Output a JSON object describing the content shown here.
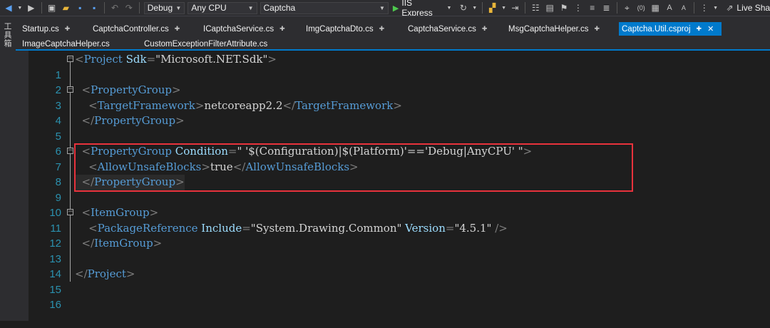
{
  "toolbar": {
    "config": "Debug",
    "platform": "Any CPU",
    "project": "Captcha",
    "run_label": "IIS Express",
    "live_share": "Live Sha"
  },
  "left_strip": {
    "label": "工具箱"
  },
  "tabs": [
    {
      "label": "Startup.cs"
    },
    {
      "label": "CaptchaController.cs"
    },
    {
      "label": "ICaptchaService.cs"
    },
    {
      "label": "ImgCaptchaDto.cs"
    },
    {
      "label": "CaptchaService.cs"
    },
    {
      "label": "MsgCaptchaHelper.cs"
    },
    {
      "label": "Captcha.Util.csproj"
    },
    {
      "label": "ImageCaptchaHelper.cs"
    },
    {
      "label": "CustomExceptionFilterAttribute.cs"
    }
  ],
  "lines": [
    {
      "n": "1",
      "open": "<",
      "tag": "Project",
      "attr": " Sdk",
      "eq": "=",
      "val": "\"Microsoft.NET.Sdk\"",
      "close": ">"
    },
    {
      "n": "2"
    },
    {
      "n": "3",
      "indent": "  ",
      "open": "<",
      "tag": "PropertyGroup",
      "close": ">"
    },
    {
      "n": "4",
      "indent": "    ",
      "open": "<",
      "tag": "TargetFramework",
      "close": ">",
      "text": "netcoreapp2.2",
      "open2": "</",
      "tag2": "TargetFramework",
      "close2": ">"
    },
    {
      "n": "5",
      "indent": "  ",
      "open": "</",
      "tag": "PropertyGroup",
      "close": ">"
    },
    {
      "n": "6"
    },
    {
      "n": "7",
      "indent": "  ",
      "open": "<",
      "tag": "PropertyGroup",
      "attr": " Condition",
      "eq": "=",
      "val": "\" '$(Configuration)|$(Platform)'=='Debug|AnyCPU' \"",
      "close": ">"
    },
    {
      "n": "8",
      "indent": "    ",
      "open": "<",
      "tag": "AllowUnsafeBlocks",
      "close": ">",
      "text": "true",
      "open2": "</",
      "tag2": "AllowUnsafeBlocks",
      "close2": ">"
    },
    {
      "n": "9",
      "indent": "  ",
      "open": "</",
      "tag": "PropertyGroup",
      "close": ">"
    },
    {
      "n": "10"
    },
    {
      "n": "11",
      "indent": "  ",
      "open": "<",
      "tag": "ItemGroup",
      "close": ">"
    },
    {
      "n": "12",
      "indent": "    ",
      "open": "<",
      "tag": "PackageReference",
      "attr": " Include",
      "eq": "=",
      "val": "\"System.Drawing.Common\"",
      "attr2": " Version",
      "eq2": "=",
      "val2": "\"4.5.1\"",
      "close": " />"
    },
    {
      "n": "13",
      "indent": "  ",
      "open": "</",
      "tag": "ItemGroup",
      "close": ">"
    },
    {
      "n": "14"
    },
    {
      "n": "15",
      "open": "</",
      "tag": "Project",
      "close": ">"
    },
    {
      "n": "16"
    }
  ]
}
